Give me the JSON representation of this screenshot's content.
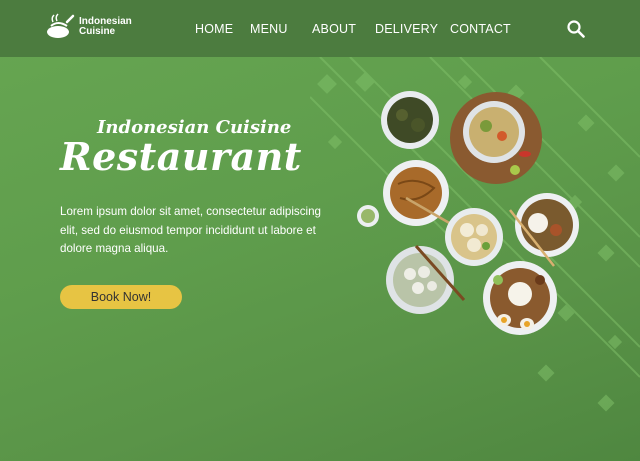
{
  "brand": {
    "line1": "Indonesian",
    "line2": "Cuisine"
  },
  "nav": {
    "home": "HOME",
    "menu": "MENU",
    "about": "ABOUT",
    "delivery": "DELIVERY",
    "contact": "CONTACT"
  },
  "hero": {
    "subtitle": "Indonesian Cuisine",
    "title": "Restaurant",
    "body": "Lorem ipsum dolor sit amet, consectetur adipiscing elit, sed do eiusmod tempor incididunt ut labore et dolore magna aliqua.",
    "cta": "Book Now!"
  },
  "colors": {
    "navbar": "#4c7c3f",
    "background": "#5f9d4c",
    "button": "#e7c443"
  },
  "icons": [
    "chef-logo-icon",
    "search-icon"
  ]
}
